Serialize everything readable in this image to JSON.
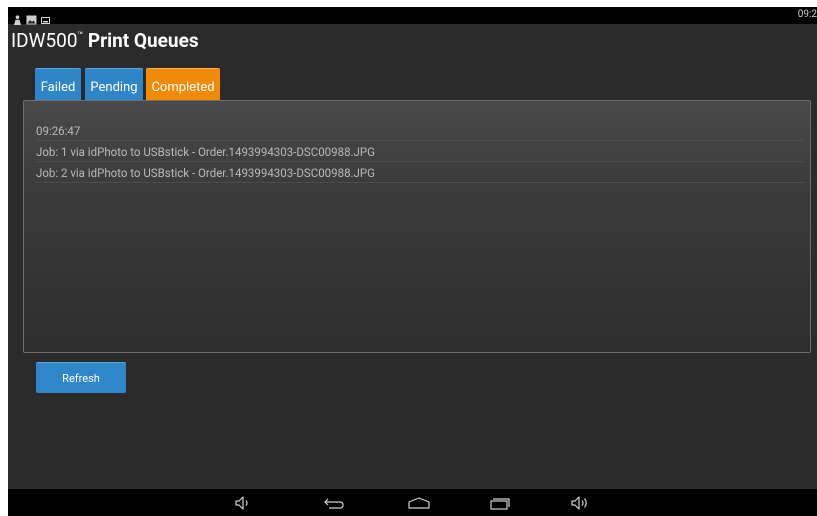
{
  "status_bar": {
    "time": "09:2",
    "icons": [
      "person-icon",
      "image-icon",
      "storage-icon"
    ]
  },
  "app": {
    "title_main": "IDW500",
    "title_mark": "™",
    "title_suffix": "Print Queues"
  },
  "tabs": [
    {
      "label": "Failed",
      "color": "#2e86c9",
      "active": false
    },
    {
      "label": "Pending",
      "color": "#2e86c9",
      "active": false
    },
    {
      "label": "Completed",
      "color": "#f08a08",
      "active": true
    }
  ],
  "queue": {
    "timestamp": "09:26:47",
    "jobs": [
      {
        "text": "Job: 1 via idPhoto to  USBstick - Order.1493994303-DSC00988.JPG"
      },
      {
        "text": "Job: 2 via idPhoto to  USBstick - Order.1493994303-DSC00988.JPG"
      }
    ]
  },
  "actions": {
    "refresh_label": "Refresh"
  },
  "nav_bar": {
    "buttons": [
      "volume-down-icon",
      "back-icon",
      "home-icon",
      "recent-apps-icon",
      "volume-up-icon"
    ]
  },
  "colors": {
    "accent_blue": "#2e86c9",
    "accent_orange": "#f08a08",
    "background": "#2b2b2b"
  }
}
